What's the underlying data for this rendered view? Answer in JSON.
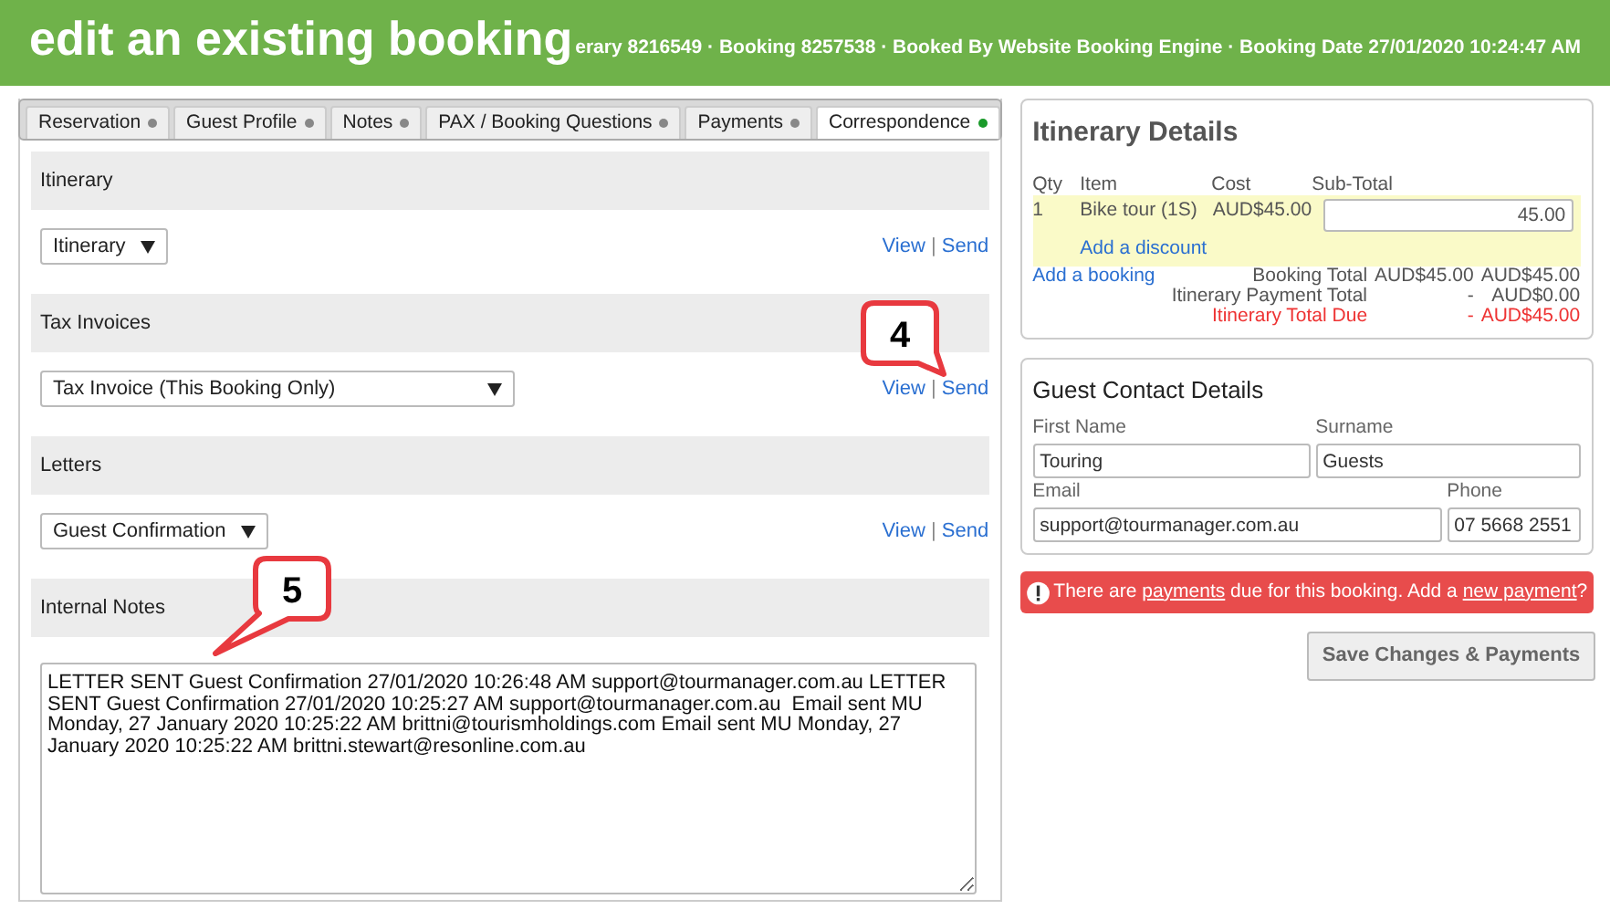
{
  "header": {
    "title": "edit an existing booking",
    "subtitle": "erary 8216549 · Booking 8257538 · Booked By Website Booking Engine · Booking Date 27/01/2020 10:24:47 AM"
  },
  "tabs": [
    {
      "label": "Reservation",
      "selected": false
    },
    {
      "label": "Guest Profile",
      "selected": false
    },
    {
      "label": "Notes",
      "selected": false
    },
    {
      "label": "PAX / Booking Questions",
      "selected": false
    },
    {
      "label": "Payments",
      "selected": false
    },
    {
      "label": "Correspondence",
      "selected": true
    }
  ],
  "sections": [
    {
      "title": "Itinerary",
      "kind": "select",
      "select": "Itinerary",
      "view": "View",
      "separator": "|",
      "send": "Send"
    },
    {
      "title": "Tax Invoices",
      "kind": "select",
      "select": "Tax Invoice (This Booking Only)",
      "view": "View",
      "separator": "|",
      "send": "Send"
    },
    {
      "title": "Letters",
      "kind": "select",
      "select": "Guest Confirmation",
      "view": "View",
      "separator": "|",
      "send": "Send"
    },
    {
      "title": "Internal Notes",
      "kind": "notes",
      "notes": "LETTER SENT Guest Confirmation 27/01/2020 10:26:48 AM support@tourmanager.com.au LETTER SENT Guest Confirmation 27/01/2020 10:25:27 AM support@tourmanager.com.au  Email sent MU Monday, 27 January 2020 10:25:22 AM brittni@tourismholdings.com Email sent MU Monday, 27 January 2020 10:25:22 AM brittni.stewart@resonline.com.au"
    }
  ],
  "itinerary": {
    "title": "Itinerary Details",
    "columns": [
      "Qty",
      "Item",
      "Cost",
      "Sub-Total"
    ],
    "rows": [
      {
        "qty": "1",
        "item": "Bike tour (1S)",
        "cost": "AUD$45.00",
        "subtotal": "45.00",
        "discount": "Add a discount"
      }
    ],
    "add_booking": "Add a booking",
    "totals": [
      {
        "label": "Booking Total",
        "value_1": "AUD$45.00",
        "value_2": "AUD$45.00",
        "kind": "normal"
      },
      {
        "label": "Itinerary Payment Total",
        "value_1": "-",
        "value_2": "AUD$0.00",
        "kind": "normal"
      },
      {
        "label": "Itinerary Total Due",
        "value_1": "-",
        "value_2": "AUD$45.00",
        "kind": "due"
      }
    ]
  },
  "guest": {
    "title": "Guest Contact Details",
    "fields": [
      {
        "label": "First Name",
        "value": "Touring"
      },
      {
        "label": "Surname",
        "value": "Guests"
      },
      {
        "label": "Email",
        "value": "support@tourmanager.com.au"
      },
      {
        "label": "Phone",
        "value": "07 5668 2551"
      }
    ]
  },
  "alert": {
    "segments": [
      {
        "kind": "text",
        "text": "There are "
      },
      {
        "kind": "link",
        "text": "payments"
      },
      {
        "kind": "text",
        "text": " due for this booking. Add a "
      },
      {
        "kind": "link",
        "text": "new payment"
      },
      {
        "kind": "text",
        "text": "?"
      }
    ]
  },
  "save_button": "Save Changes & Payments",
  "callouts": [
    {
      "number": "4"
    },
    {
      "number": "5"
    }
  ]
}
